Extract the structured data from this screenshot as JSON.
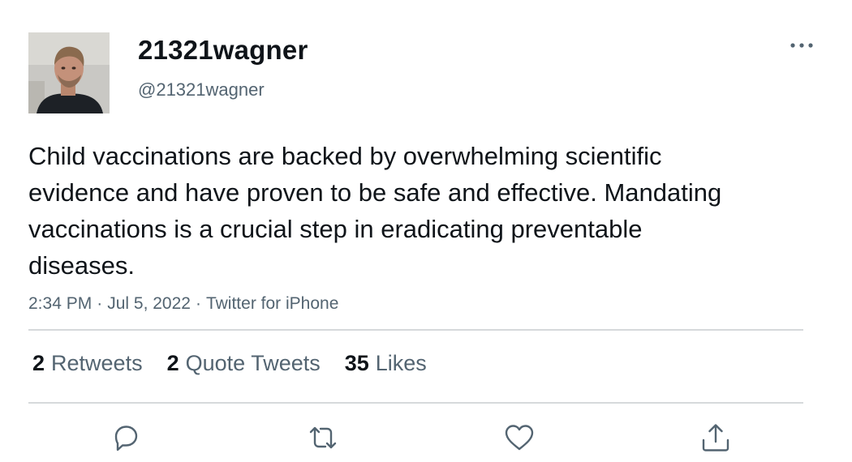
{
  "tweet": {
    "display_name": "21321wagner",
    "handle": "@21321wagner",
    "text": "Child vaccinations are backed by overwhelming scientific evidence and have proven to be safe and effective. Mandating vaccinations is a crucial step in eradicating preventable diseases.",
    "time": "2:34 PM",
    "date": "Jul 5, 2022",
    "source": "Twitter for iPhone",
    "separator": "·"
  },
  "stats": {
    "retweets_count": "2",
    "retweets_label": "Retweets",
    "quotes_count": "2",
    "quotes_label": "Quote Tweets",
    "likes_count": "35",
    "likes_label": "Likes"
  },
  "icons": {
    "more": "more-horizontal-icon",
    "reply": "reply-icon",
    "retweet": "retweet-icon",
    "like": "heart-icon",
    "share": "share-icon"
  },
  "colors": {
    "text_primary": "#0f1419",
    "text_secondary": "#536471",
    "divider": "#d6d9db",
    "icon": "#536471"
  }
}
